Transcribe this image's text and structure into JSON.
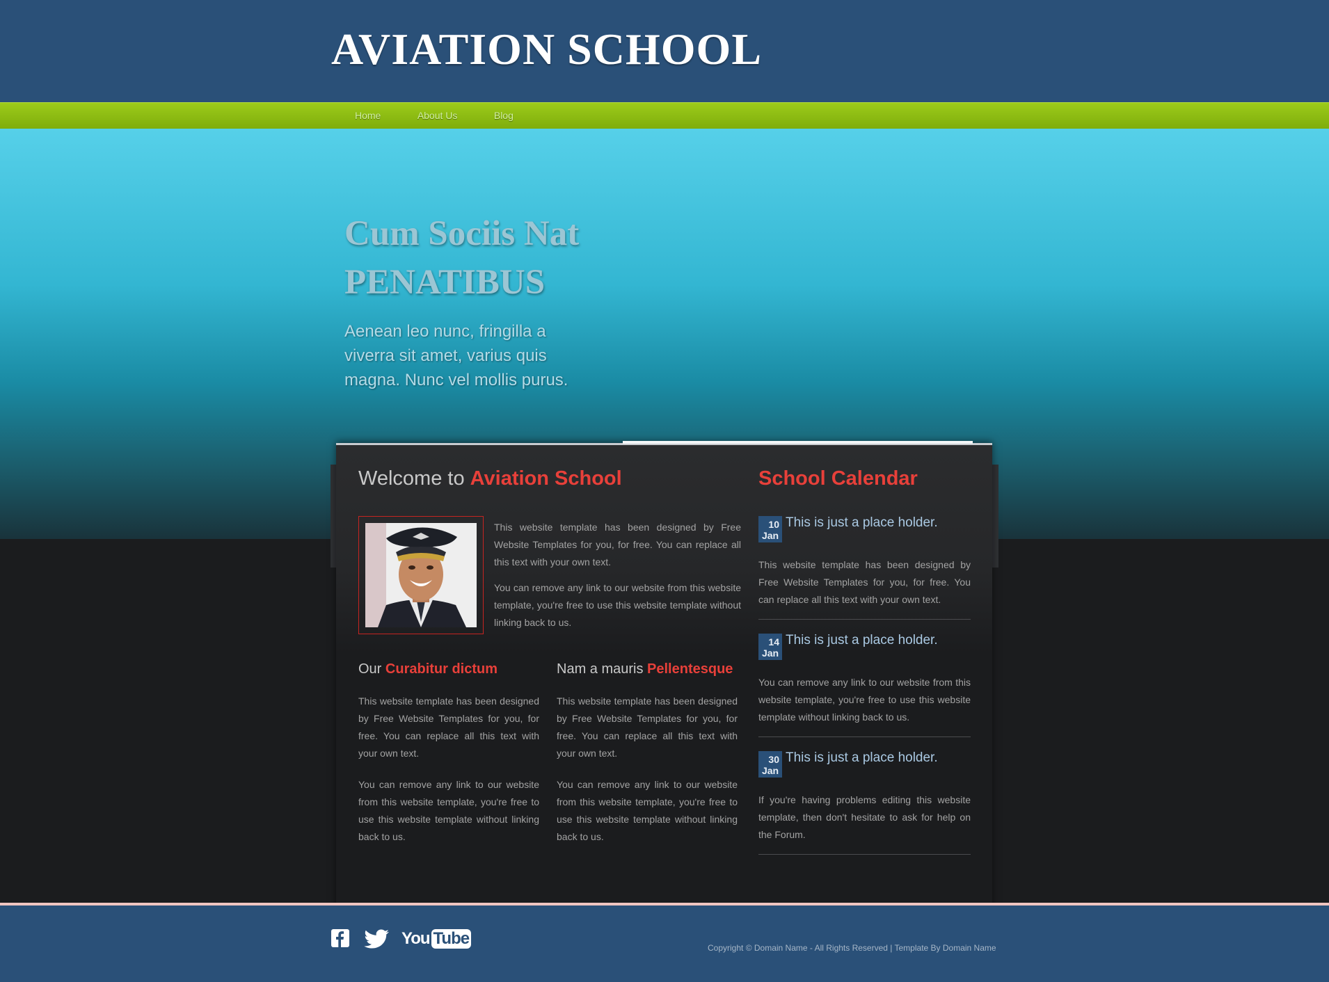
{
  "header": {
    "logo": "AVIATION SCHOOL"
  },
  "nav": {
    "items": [
      "Home",
      "About Us",
      "Blog"
    ]
  },
  "hero": {
    "title_line1": "Cum Sociis Nat",
    "title_line2": "PENATIBUS",
    "text": "Aenean leo nunc, fringilla a viverra sit amet, varius quis magna. Nunc vel mollis purus."
  },
  "welcome": {
    "title_plain": "Welcome to ",
    "title_accent": "Aviation School",
    "p1": "This website template has been designed by Free Website Templates for you, for free. You can replace all this text with your own text.",
    "p2": "You can remove any link to our website from this website template, you're free to use this website template without linking back to us."
  },
  "columns": [
    {
      "title_plain": "Our ",
      "title_accent": "Curabitur dictum",
      "p1": "This website template has been designed by Free Website Templates for you, for free. You can replace all this text with your own text.",
      "p2": "You can remove any link to our website from this website template, you're free to use this website template without linking back to us."
    },
    {
      "title_plain": "Nam a mauris ",
      "title_accent": "Pellentesque",
      "p1": "This website template has been designed by Free Website Templates for you, for free. You can replace all this text with your own text.",
      "p2": "You can remove any link to our website from this website template, you're free to use this website template without linking back to us."
    }
  ],
  "calendar": {
    "title": "School Calendar",
    "events": [
      {
        "day": "10",
        "month": "Jan",
        "title": "This is just a place holder.",
        "text": "This website template has been designed by Free Website Templates for you, for free. You can replace all this text with your own text."
      },
      {
        "day": "14",
        "month": "Jan",
        "title": "This is just a place holder.",
        "text": "You can remove any link to our website from this website template, you're free to use this website template without linking back to us."
      },
      {
        "day": "30",
        "month": "Jan",
        "title": "This is just a place holder.",
        "text": "If you're having problems editing this website template, then don't hesitate to ask for help on the Forum."
      }
    ]
  },
  "footer": {
    "social_icons": [
      "facebook-icon",
      "twitter-icon",
      "youtube-icon"
    ],
    "youtube_you": "You",
    "youtube_tube": "Tube",
    "copyright": "Copyright © Domain Name - All Rights Reserved | Template By Domain Name"
  },
  "colors": {
    "header_bg": "#2a5078",
    "nav_green": "#8fbf12",
    "accent_red": "#e8403a",
    "date_badge": "#2a5078"
  }
}
